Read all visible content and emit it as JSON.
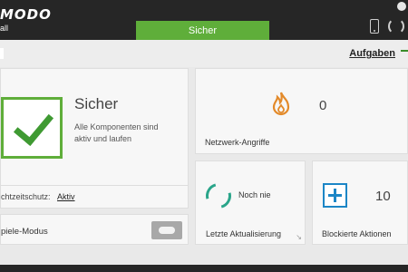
{
  "header": {
    "brand": "MODO",
    "brand_sub": "all",
    "tab_label": "Sicher",
    "icons": [
      "phone-icon",
      "sync-icon"
    ]
  },
  "subbar": {
    "aufgaben_label": "Aufgaben"
  },
  "main_status": {
    "title": "Sicher",
    "description": "Alle Komponenten sind aktiv und laufen",
    "realtime_label": "chtzeitschutz:",
    "realtime_value": "Aktiv"
  },
  "game_mode": {
    "label": "piele-Modus"
  },
  "network": {
    "count": "0",
    "label": "Netzwerk-Angriffe"
  },
  "update": {
    "status": "Noch nie",
    "label": "Letzte Aktualisierung"
  },
  "blocked": {
    "count": "10",
    "label": "Blockierte Aktionen"
  },
  "colors": {
    "accent_green": "#5fae3a",
    "header_bg": "#262626",
    "fire_orange": "#e38a2a",
    "update_teal": "#2aa58a",
    "plus_blue": "#1c86c6"
  }
}
